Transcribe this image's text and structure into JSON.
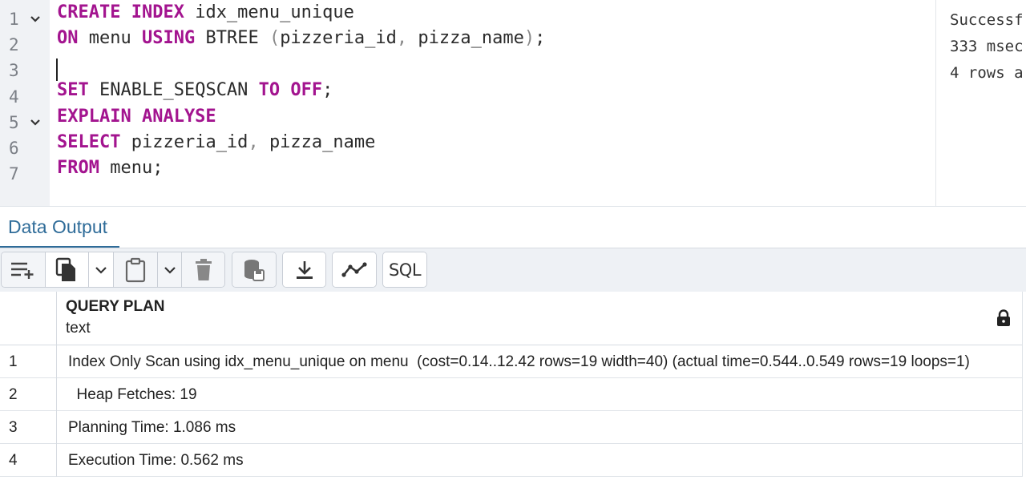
{
  "editor": {
    "line_numbers": [
      "1",
      "2",
      "3",
      "4",
      "5",
      "6",
      "7"
    ],
    "lines": [
      [
        {
          "t": "CREATE INDEX",
          "c": "kw"
        },
        {
          "t": " idx_menu_unique",
          "c": ""
        }
      ],
      [
        {
          "t": "ON",
          "c": "kw"
        },
        {
          "t": " menu ",
          "c": ""
        },
        {
          "t": "USING",
          "c": "kw"
        },
        {
          "t": " BTREE ",
          "c": ""
        },
        {
          "t": "(",
          "c": "pn"
        },
        {
          "t": "pizzeria_id",
          "c": ""
        },
        {
          "t": ", ",
          "c": "pn"
        },
        {
          "t": "pizza_name",
          "c": ""
        },
        {
          "t": ")",
          "c": "pn"
        },
        {
          "t": ";",
          "c": ""
        }
      ],
      [],
      [
        {
          "t": "SET",
          "c": "kw"
        },
        {
          "t": " ENABLE_SEQSCAN ",
          "c": ""
        },
        {
          "t": "TO OFF",
          "c": "kw"
        },
        {
          "t": ";",
          "c": ""
        }
      ],
      [
        {
          "t": "EXPLAIN ANALYSE",
          "c": "kw"
        }
      ],
      [
        {
          "t": "SELECT",
          "c": "kw"
        },
        {
          "t": " pizzeria_id",
          "c": ""
        },
        {
          "t": ", ",
          "c": "pn"
        },
        {
          "t": "pizza_name",
          "c": ""
        }
      ],
      [
        {
          "t": "FROM",
          "c": "kw"
        },
        {
          "t": " menu;",
          "c": ""
        }
      ]
    ]
  },
  "messages": {
    "line1": "Successf",
    "line2": "333 msec",
    "line3": "4 rows a"
  },
  "tabs": {
    "data_output": "Data Output"
  },
  "toolbar": {
    "icons": [
      "add-row-icon",
      "copy-icon",
      "copy-dropdown-icon",
      "paste-icon",
      "paste-dropdown-icon",
      "delete-icon",
      "save-data-icon",
      "download-icon",
      "graph-icon"
    ],
    "sql_label": "SQL"
  },
  "grid": {
    "column_name": "QUERY PLAN",
    "column_type": "text",
    "rows": [
      {
        "num": "1",
        "value": "Index Only Scan using idx_menu_unique on menu  (cost=0.14..12.42 rows=19 width=40) (actual time=0.544..0.549 rows=19 loops=1)"
      },
      {
        "num": "2",
        "value": "  Heap Fetches: 19"
      },
      {
        "num": "3",
        "value": "Planning Time: 1.086 ms"
      },
      {
        "num": "4",
        "value": "Execution Time: 0.562 ms"
      }
    ]
  },
  "colors": {
    "keyword": "#a3148f",
    "accent": "#2f6c99"
  }
}
